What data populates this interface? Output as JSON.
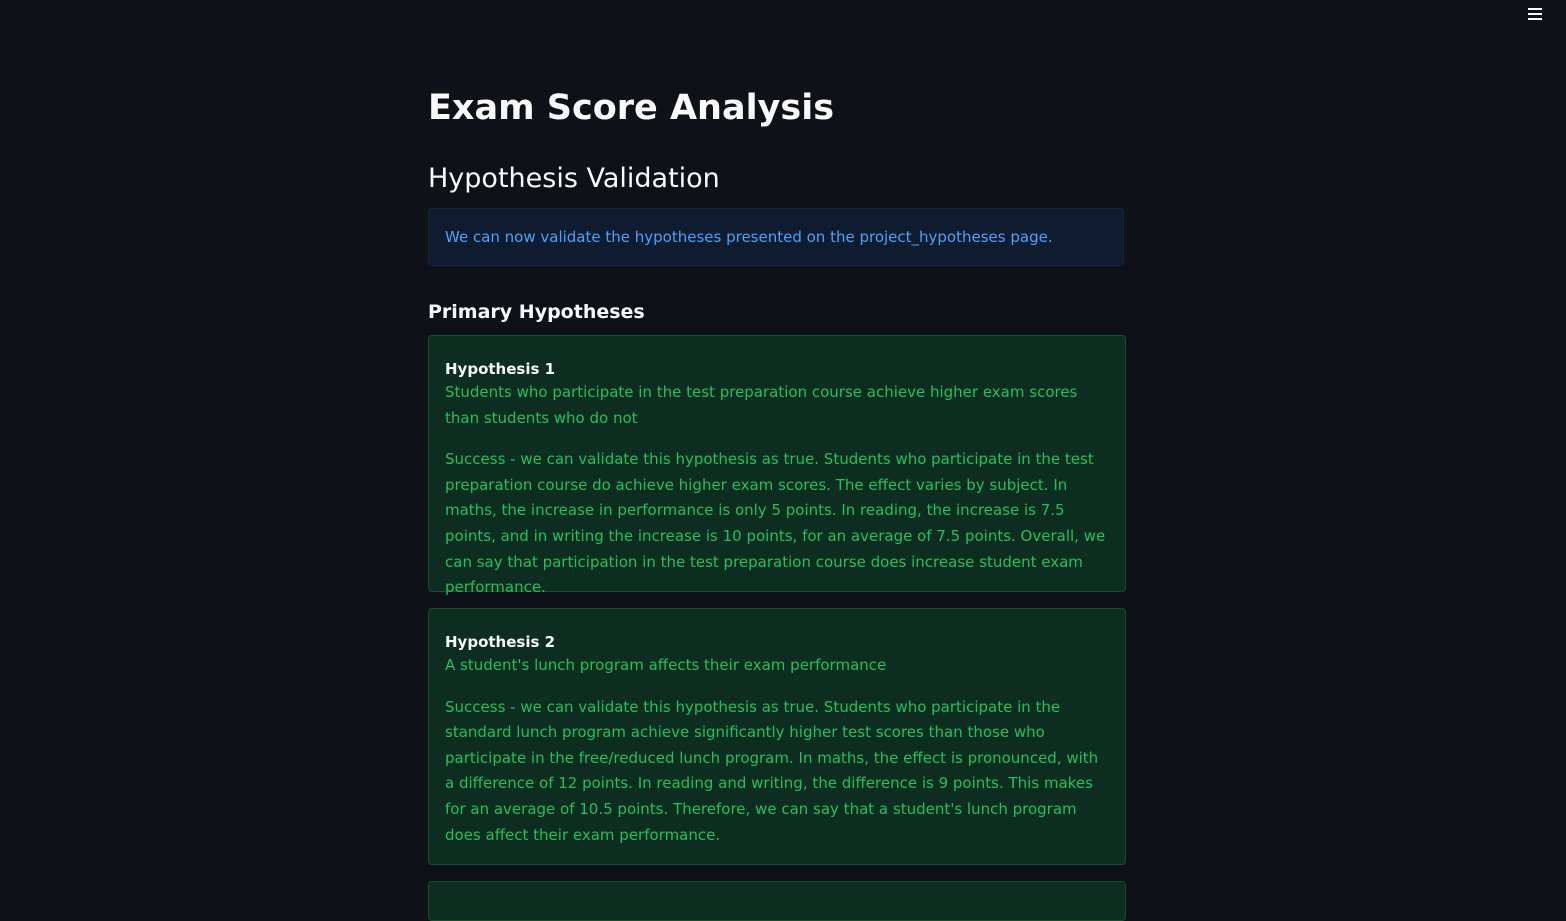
{
  "header": {
    "menu_icon": "hamburger-menu-icon"
  },
  "main": {
    "title": "Exam Score Analysis",
    "section_title": "Hypothesis Validation",
    "info_message": "We can now validate the hypotheses presented on the project_hypotheses page.",
    "subsection_title": "Primary Hypotheses",
    "hypotheses": [
      {
        "title": "Hypothesis 1",
        "statement": "Students who participate in the test preparation course achieve higher exam scores than students who do not",
        "result": "Success - we can validate this hypothesis as true. Students who participate in the test preparation course do achieve higher exam scores. The effect varies by subject. In maths, the increase in performance is only 5 points. In reading, the increase is 7.5 points, and in writing the increase is 10 points, for an average of 7.5 points. Overall, we can say that participation in the test preparation course does increase student exam performance."
      },
      {
        "title": "Hypothesis 2",
        "statement": "A student's lunch program affects their exam performance",
        "result": "Success - we can validate this hypothesis as true. Students who participate in the standard lunch program achieve significantly higher test scores than those who participate in the free/reduced lunch program. In maths, the effect is pronounced, with a difference of 12 points. In reading and writing, the difference is 9 points. This makes for an average of 10.5 points. Therefore, we can say that a student's lunch program does affect their exam performance."
      }
    ]
  },
  "colors": {
    "background": "#0e1117",
    "info_background": "#0f1b2e",
    "info_text": "#4aa2ff",
    "success_background": "#0c2d1f",
    "success_text": "#23c15b"
  }
}
